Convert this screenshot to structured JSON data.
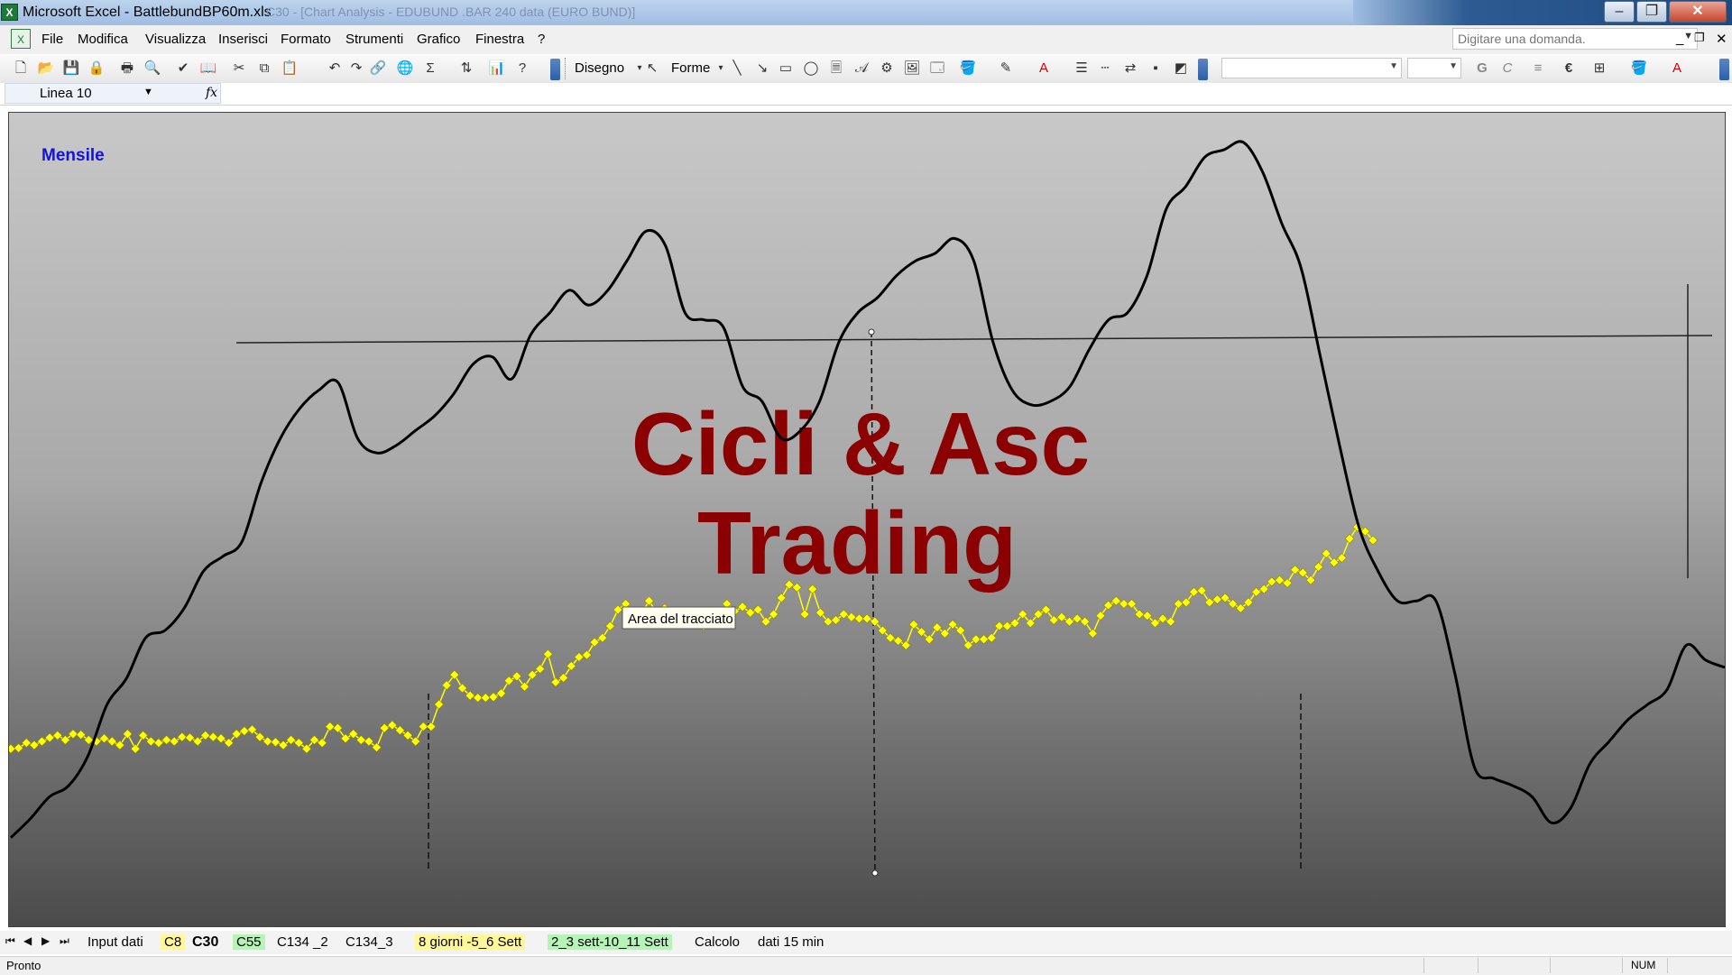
{
  "window": {
    "title": "Microsoft Excel - BattlebundBP60m.xls",
    "title_faded": "C30 - [Chart Analysis - EDUBUND .BAR 240 data (EURO BUND)]"
  },
  "menu": {
    "items": [
      "File",
      "Modifica",
      "Visualizza",
      "Inserisci",
      "Formato",
      "Strumenti",
      "Grafico",
      "Finestra",
      "?"
    ],
    "help_placeholder": "Digitare una domanda."
  },
  "toolbar": {
    "disegno_label": "Disegno",
    "forme_label": "Forme",
    "bold_label": "G",
    "italic_label": "C",
    "euro_label": "€"
  },
  "namebox": {
    "value": "Linea 10",
    "fx": "fx"
  },
  "chart": {
    "label_mensile": "Mensile",
    "watermark_line1": "Cicli & Asc",
    "watermark_line2": "Trading",
    "tooltip": "Area del tracciato",
    "colors": {
      "price": "#ffff00",
      "cycle": "#000000",
      "watermark": "#8b0000",
      "mensile": "#1414d8"
    }
  },
  "chart_data": {
    "type": "line",
    "title": "",
    "xlabel": "",
    "ylabel": "",
    "series": [
      {
        "values": [
          640,
          641,
          648,
          645,
          650,
          655,
          658,
          652,
          660,
          659,
          652,
          650,
          654,
          650,
          645,
          660,
          640,
          658,
          650,
          648,
          652,
          650,
          656,
          655,
          650,
          658,
          656,
          654,
          648,
          660,
          664,
          666,
          656,
          650,
          649,
          645,
          652,
          648,
          640,
          652,
          648,
          670,
          668,
          654,
          660,
          652,
          650,
          642,
          668,
          672,
          665,
          658,
          650,
          670,
          670,
          700,
          726,
          740,
          722,
          712,
          709,
          709,
          710,
          715,
          732,
          738,
          724,
          740,
          748,
          768,
          730,
          736,
          752,
          764,
          767,
          784,
          790,
          806,
          828,
          836,
          822,
          822,
          840,
          824,
          830,
          820,
          818,
          810,
          812,
          806,
          812,
          820,
          836,
          826,
          832,
          824,
          828,
          812,
          822,
          844,
          862,
          858,
          822,
          856,
          824,
          812,
          814,
          822,
          818,
          816,
          816,
          812,
          800,
          790,
          786,
          780,
          808,
          798,
          788,
          804,
          796,
          808,
          800,
          780,
          788,
          788,
          790,
          806,
          806,
          810,
          822,
          810,
          822,
          828,
          814,
          818,
          812,
          816,
          812,
          796,
          820,
          834,
          840,
          836,
          836,
          822,
          820,
          810,
          816,
          812,
          836,
          838,
          852,
          854,
          838,
          842,
          844,
          836,
          830,
          838,
          852,
          856,
          866,
          868,
          864,
          882,
          878,
          868,
          886,
          904,
          892,
          898,
          924,
          940,
          934,
          922
        ]
      },
      {
        "values": [
          520,
          545,
          575,
          590,
          630,
          700,
          735,
          790,
          800,
          830,
          880,
          900,
          920,
          1000,
          1060,
          1100,
          1125,
          1135,
          1060,
          1040,
          1050,
          1070,
          1090,
          1120,
          1160,
          1170,
          1140,
          1200,
          1230,
          1260,
          1240,
          1260,
          1300,
          1340,
          1320,
          1230,
          1220,
          1210,
          1130,
          1110,
          1060,
          1070,
          1110,
          1190,
          1230,
          1250,
          1280,
          1300,
          1310,
          1330,
          1300,
          1190,
          1125,
          1105,
          1110,
          1130,
          1180,
          1220,
          1230,
          1280,
          1370,
          1400,
          1440,
          1450,
          1460,
          1420,
          1350,
          1290,
          1170,
          1050,
          940,
          880,
          840,
          840,
          840,
          740,
          615,
          600,
          590,
          575,
          540,
          560,
          620,
          650,
          680,
          700,
          720,
          780,
          760,
          750
        ]
      }
    ]
  }
}
